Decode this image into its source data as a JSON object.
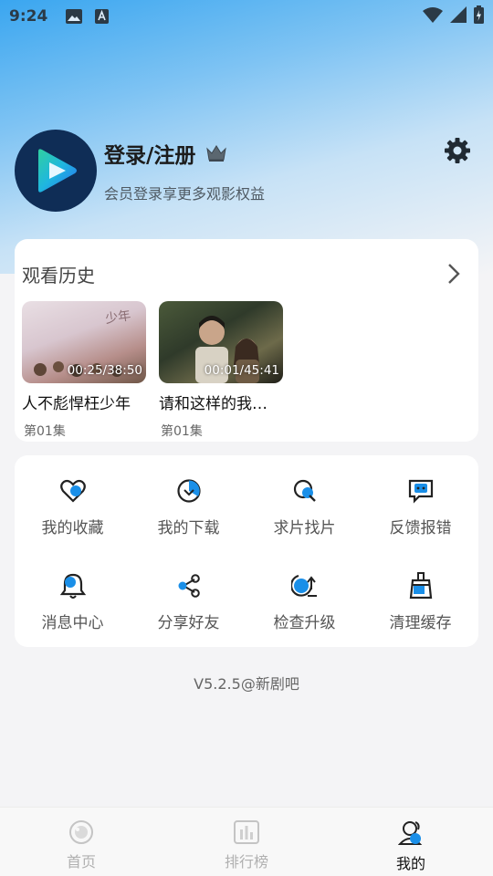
{
  "status_bar": {
    "time": "9:24"
  },
  "profile": {
    "login_title": "登录/注册",
    "subtitle": "会员登录享更多观影权益"
  },
  "history": {
    "title": "观看历史",
    "items": [
      {
        "name": "人不彪悍枉少年",
        "progress": "00:25/38:50",
        "episode": "第01集"
      },
      {
        "name": "请和这样的我…",
        "progress": "00:01/45:41",
        "episode": "第01集"
      }
    ]
  },
  "menu": {
    "items": [
      {
        "label": "我的收藏",
        "icon": "heart-icon"
      },
      {
        "label": "我的下载",
        "icon": "download-icon"
      },
      {
        "label": "求片找片",
        "icon": "search-icon"
      },
      {
        "label": "反馈报错",
        "icon": "feedback-icon"
      },
      {
        "label": "消息中心",
        "icon": "bell-icon"
      },
      {
        "label": "分享好友",
        "icon": "share-icon"
      },
      {
        "label": "检查升级",
        "icon": "upgrade-icon"
      },
      {
        "label": "清理缓存",
        "icon": "broom-icon"
      }
    ]
  },
  "version": "V5.2.5@新剧吧",
  "tabbar": {
    "tabs": [
      {
        "label": "首页",
        "active": false
      },
      {
        "label": "排行榜",
        "active": false
      },
      {
        "label": "我的",
        "active": true
      }
    ]
  },
  "colors": {
    "accent": "#1a8fe8",
    "avatar_bg": "#0f2d56",
    "hero_top": "#3aa6f0"
  }
}
